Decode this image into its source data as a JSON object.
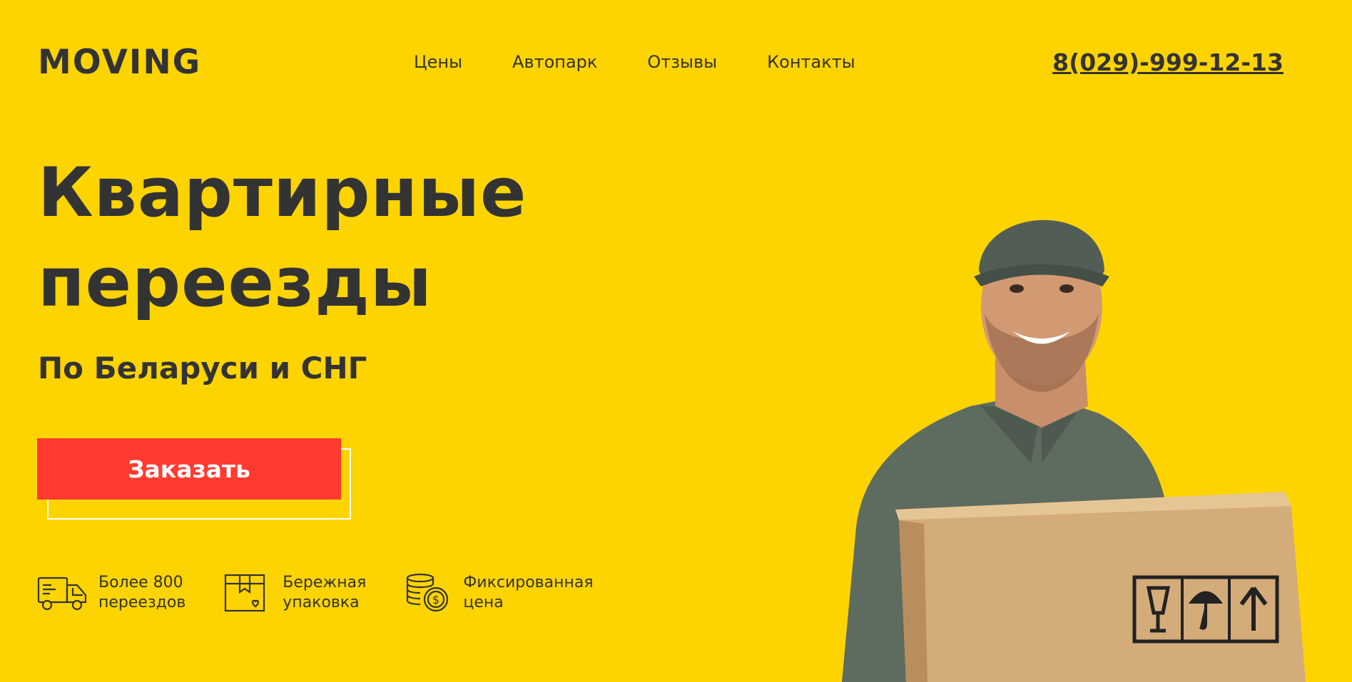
{
  "header": {
    "logo": "MOVING",
    "nav": [
      "Цены",
      "Автопарк",
      "Отзывы",
      "Контакты"
    ],
    "phone": "8(029)-999-12-13"
  },
  "hero": {
    "title_line1": "Квартирные",
    "title_line2": "переезды",
    "subtitle": "По Беларуси и СНГ",
    "cta_label": "Заказать"
  },
  "features": [
    {
      "icon": "truck-icon",
      "line1": "Более 800",
      "line2": "переездов"
    },
    {
      "icon": "box-icon",
      "line1": "Бережная",
      "line2": "упаковка"
    },
    {
      "icon": "coins-icon",
      "line1": "Фиксированная",
      "line2": "цена"
    }
  ],
  "colors": {
    "background": "#FED400",
    "text": "#333333",
    "cta": "#FF3B30"
  }
}
